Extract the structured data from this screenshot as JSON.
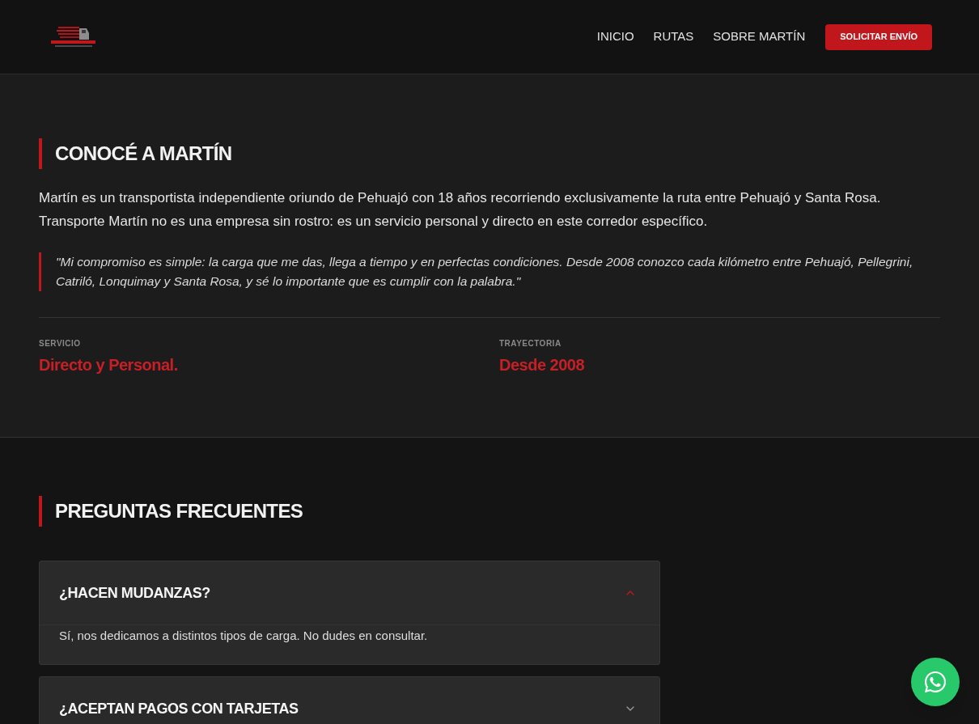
{
  "header": {
    "nav": [
      "INICIO",
      "RUTAS",
      "SOBRE MARTÍN"
    ],
    "cta": "SOLICITAR ENVÍO"
  },
  "about": {
    "title": "CONOCÉ A MARTÍN",
    "paragraph": "Martín es un transportista independiente oriundo de Pehuajó con 18 años recorriendo exclusivamente la ruta entre Pehuajó y Santa Rosa. Transporte Martín no es una empresa sin rostro: es un servicio personal y directo en este corredor específico.",
    "quote": "\"Mi compromiso es simple: la carga que me das, llega a tiempo y en perfectas condiciones. Desde 2008 conozco cada kilómetro entre Pehuajó, Pellegrini, Catriló, Lonquimay y Santa Rosa, y sé lo importante que es cumplir con la palabra.\"",
    "stats": [
      {
        "label": "SERVICIO",
        "value": "Directo y Personal."
      },
      {
        "label": "TRAYECTORIA",
        "value": "Desde 2008"
      }
    ]
  },
  "faq": {
    "title": "PREGUNTAS FRECUENTES",
    "items": [
      {
        "question": "¿HACEN MUDANZAS?",
        "expanded": true,
        "answer": "Sí, nos dedicamos a distintos tipos de carga. No dudes en consultar."
      },
      {
        "question": "¿ACEPTAN PAGOS CON TARJETAS",
        "expanded": false
      }
    ]
  }
}
